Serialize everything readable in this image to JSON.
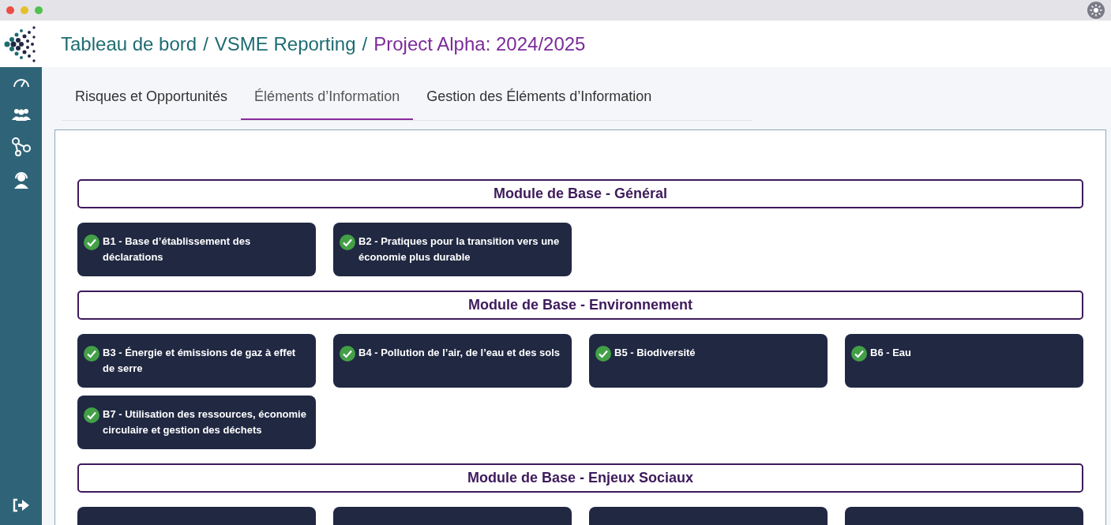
{
  "breadcrumb": [
    {
      "label": "Tableau de bord",
      "kind": "link"
    },
    {
      "label": "/",
      "kind": "separator"
    },
    {
      "label": "VSME Reporting",
      "kind": "link"
    },
    {
      "label": "/",
      "kind": "separator"
    },
    {
      "label": "Project Alpha: 2024/2025",
      "kind": "current"
    }
  ],
  "tabs": [
    {
      "label": "Risques et Opportunités",
      "selected": false
    },
    {
      "label": "Éléments d’Information",
      "selected": true
    },
    {
      "label": "Gestion des Éléments d’Information",
      "selected": false
    }
  ],
  "sections": [
    {
      "title": "Module de Base - Général",
      "items": [
        {
          "kind": "card",
          "label": "B1 - Base d’établissement des déclarations",
          "completed": true
        },
        {
          "kind": "card",
          "label": "B2 - Pratiques pour la transition vers une économie plus durable",
          "completed": true
        }
      ]
    },
    {
      "title": "Module de Base - Environnement",
      "items": [
        {
          "kind": "card",
          "label": "B3 - Énergie et émissions de gaz à effet de serre",
          "completed": true
        },
        {
          "kind": "card",
          "label": "B4 - Pollution de l’air, de l’eau et des sols",
          "completed": true
        },
        {
          "kind": "card",
          "label": "B5 - Biodiversité",
          "completed": true
        },
        {
          "kind": "card",
          "label": "B6 - Eau",
          "completed": true
        },
        {
          "kind": "card",
          "label": "B7 - Utilisation des ressources, économie circulaire et gestion des déchets",
          "completed": true
        }
      ]
    },
    {
      "title": "Module de Base - Enjeux Sociaux",
      "items": [
        {
          "kind": "hidden-card"
        },
        {
          "kind": "hidden-card"
        },
        {
          "kind": "hidden-card"
        },
        {
          "kind": "hidden-card"
        }
      ]
    }
  ]
}
